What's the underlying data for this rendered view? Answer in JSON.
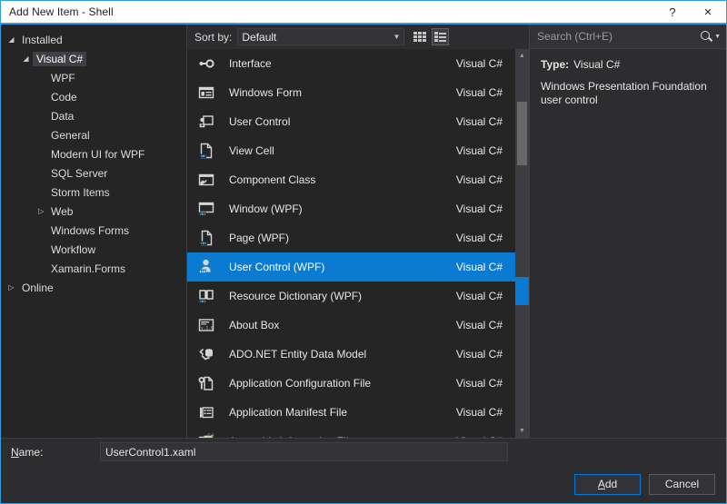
{
  "window": {
    "title": "Add New Item - Shell",
    "help_label": "?",
    "close_label": "×"
  },
  "tree": {
    "nodes": [
      {
        "label": "Installed",
        "level": 0,
        "expander": "expanded",
        "selected": false
      },
      {
        "label": "Visual C#",
        "level": 1,
        "expander": "expanded",
        "selected": true
      },
      {
        "label": "WPF",
        "level": 2,
        "expander": "none",
        "selected": false
      },
      {
        "label": "Code",
        "level": 2,
        "expander": "none",
        "selected": false
      },
      {
        "label": "Data",
        "level": 2,
        "expander": "none",
        "selected": false
      },
      {
        "label": "General",
        "level": 2,
        "expander": "none",
        "selected": false
      },
      {
        "label": "Modern UI for WPF",
        "level": 2,
        "expander": "none",
        "selected": false
      },
      {
        "label": "SQL Server",
        "level": 2,
        "expander": "none",
        "selected": false
      },
      {
        "label": "Storm Items",
        "level": 2,
        "expander": "none",
        "selected": false
      },
      {
        "label": "Web",
        "level": 2,
        "expander": "collapsed",
        "selected": false
      },
      {
        "label": "Windows Forms",
        "level": 2,
        "expander": "none",
        "selected": false
      },
      {
        "label": "Workflow",
        "level": 2,
        "expander": "none",
        "selected": false
      },
      {
        "label": "Xamarin.Forms",
        "level": 2,
        "expander": "none",
        "selected": false
      },
      {
        "label": "Online",
        "level": 0,
        "expander": "collapsed",
        "selected": false
      }
    ]
  },
  "toolbar": {
    "sort_by_label": "Sort by:",
    "sort_by_value": "Default",
    "sort_by_options": [
      "Default"
    ],
    "tiles_view_name": "tiles-view",
    "list_view_name": "list-view"
  },
  "list": {
    "items": [
      {
        "name": "Interface",
        "lang": "Visual C#",
        "icon": "interface-icon",
        "selected": false
      },
      {
        "name": "Windows Form",
        "lang": "Visual C#",
        "icon": "windows-form-icon",
        "selected": false
      },
      {
        "name": "User Control",
        "lang": "Visual C#",
        "icon": "user-control-icon",
        "selected": false
      },
      {
        "name": "View Cell",
        "lang": "Visual C#",
        "icon": "view-cell-icon",
        "selected": false
      },
      {
        "name": "Component Class",
        "lang": "Visual C#",
        "icon": "component-class-icon",
        "selected": false
      },
      {
        "name": "Window (WPF)",
        "lang": "Visual C#",
        "icon": "window-wpf-icon",
        "selected": false
      },
      {
        "name": "Page (WPF)",
        "lang": "Visual C#",
        "icon": "page-wpf-icon",
        "selected": false
      },
      {
        "name": "User Control (WPF)",
        "lang": "Visual C#",
        "icon": "user-control-wpf-icon",
        "selected": true
      },
      {
        "name": "Resource Dictionary (WPF)",
        "lang": "Visual C#",
        "icon": "resource-dictionary-icon",
        "selected": false
      },
      {
        "name": "About Box",
        "lang": "Visual C#",
        "icon": "about-box-icon",
        "selected": false
      },
      {
        "name": "ADO.NET Entity Data Model",
        "lang": "Visual C#",
        "icon": "ado-net-entity-icon",
        "selected": false
      },
      {
        "name": "Application Configuration File",
        "lang": "Visual C#",
        "icon": "app-config-icon",
        "selected": false
      },
      {
        "name": "Application Manifest File",
        "lang": "Visual C#",
        "icon": "app-manifest-icon",
        "selected": false
      },
      {
        "name": "Assembly Information File",
        "lang": "Visual C#",
        "icon": "assembly-info-icon",
        "selected": false
      }
    ]
  },
  "search": {
    "placeholder": "Search (Ctrl+E)",
    "value": ""
  },
  "details": {
    "type_key": "Type:",
    "type_value": "Visual C#",
    "description": "Windows Presentation Foundation user control"
  },
  "footer": {
    "name_label_prefix": "",
    "name_label_accel": "N",
    "name_label_suffix": "ame:",
    "name_value": "UserControl1.xaml",
    "add_accel": "A",
    "add_suffix": "dd",
    "cancel_label": "Cancel"
  },
  "colors": {
    "accent": "#0078d7",
    "selection": "#0b7ad1",
    "title_border": "#2d9fe0",
    "panel_bg": "#2d2d30",
    "list_bg": "#252526"
  }
}
